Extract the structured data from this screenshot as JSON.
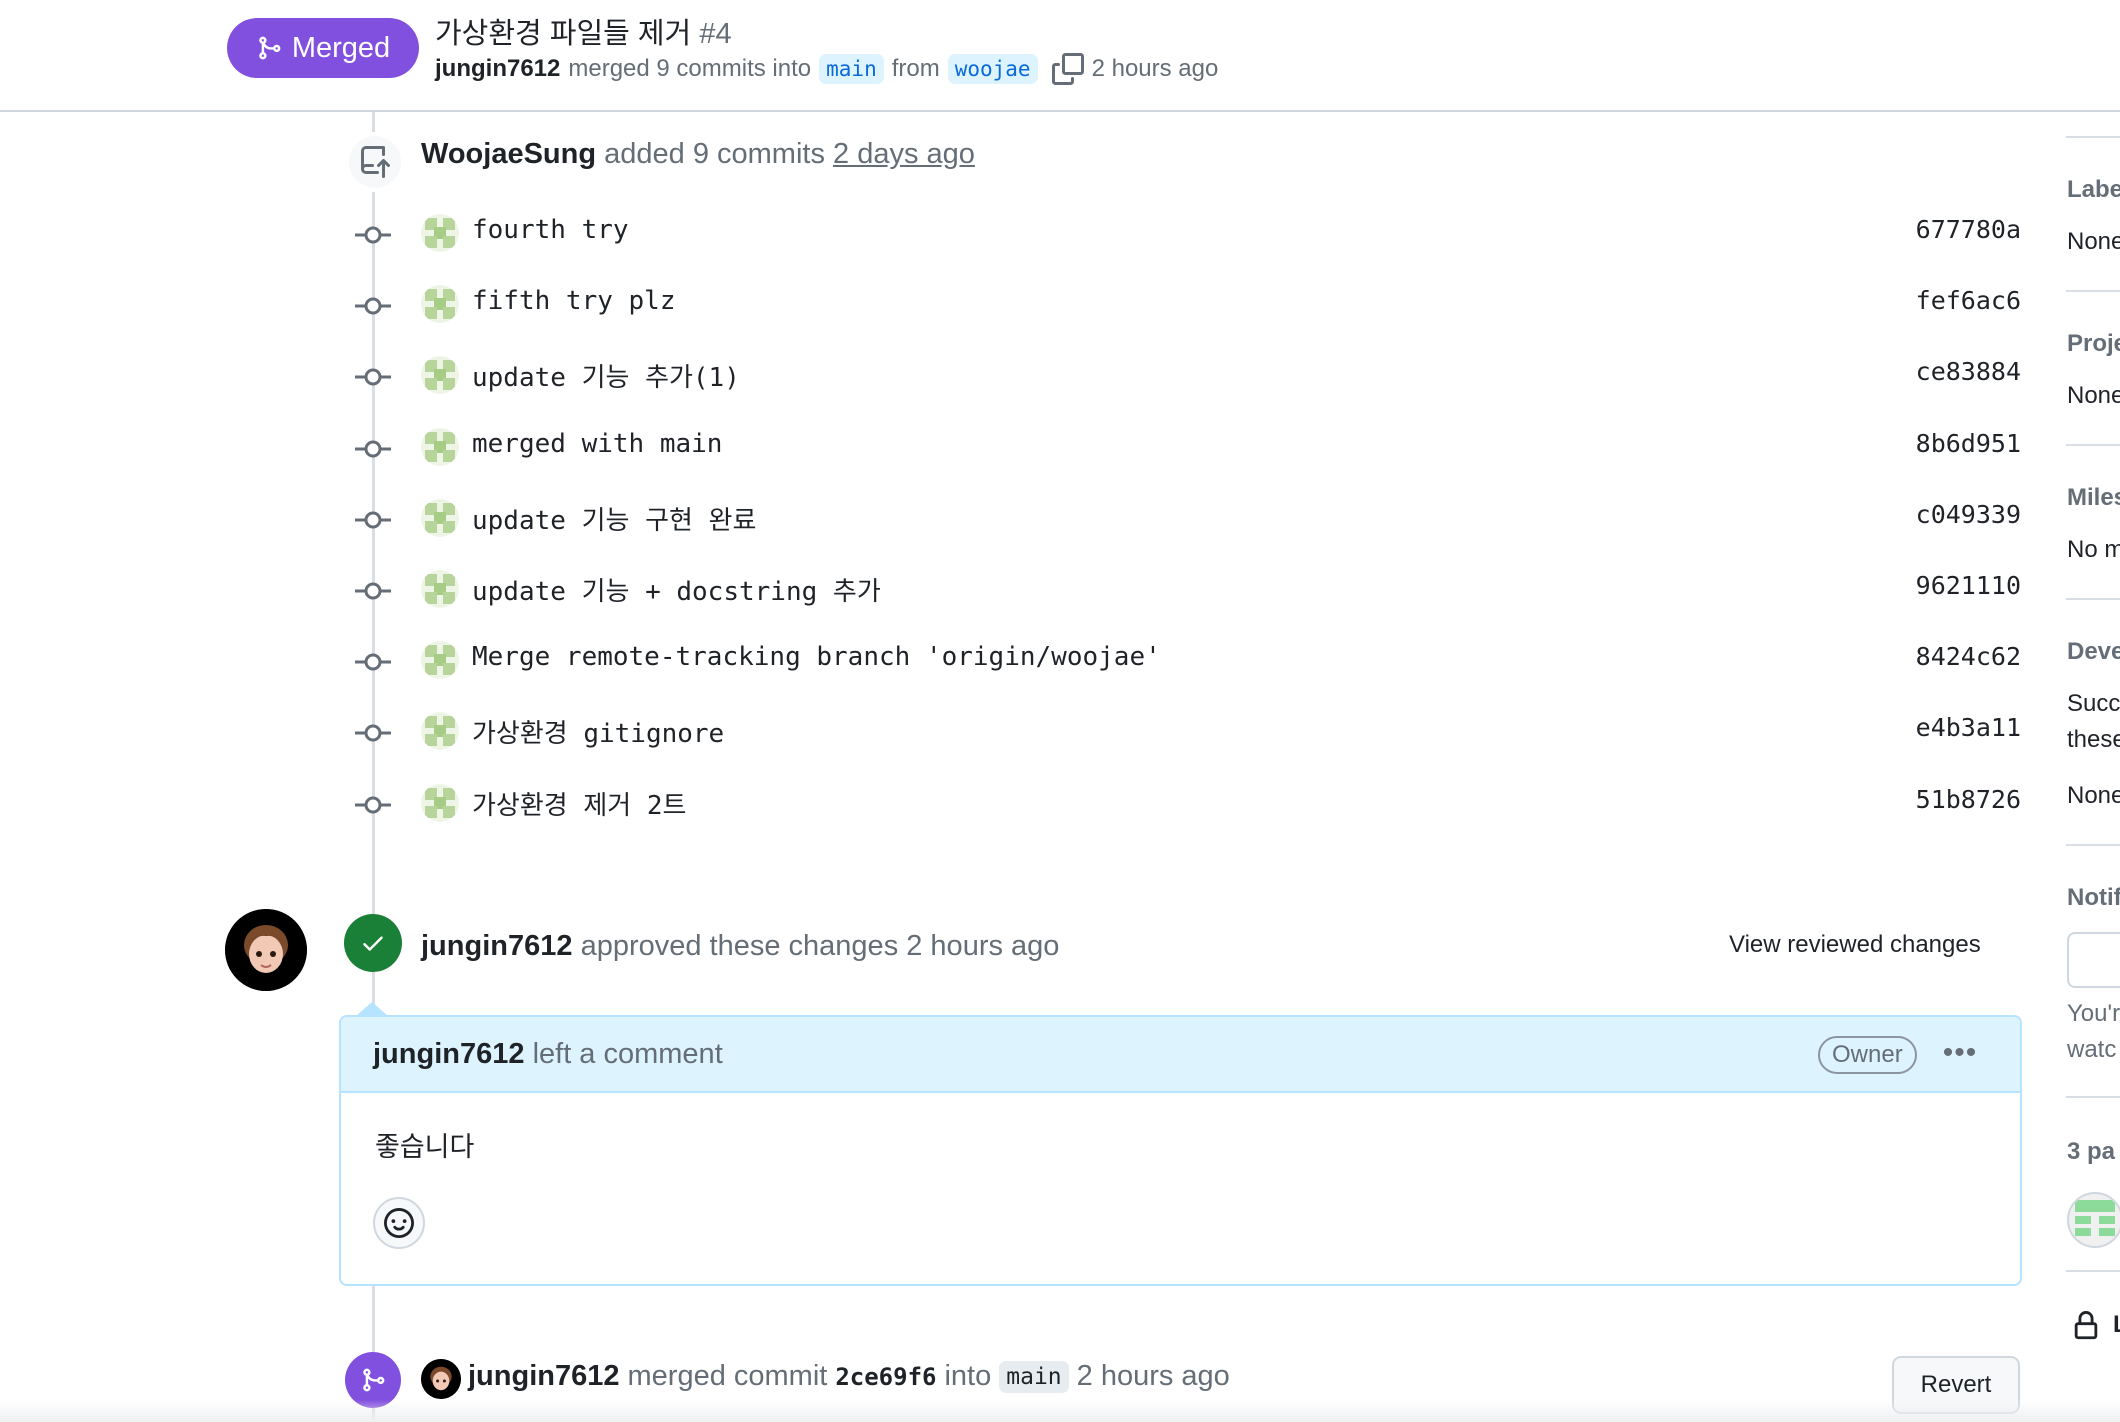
{
  "header": {
    "status_badge": "Merged",
    "title": "가상환경 파일들 제거",
    "number": "#4",
    "merger": "jungin7612",
    "merge_text": "merged 9 commits into",
    "base_branch": "main",
    "from_text": "from",
    "head_branch": "woojae",
    "time": "2 hours ago"
  },
  "push_event": {
    "author": "WoojaeSung",
    "action": "added 9 commits",
    "time": "2 days ago"
  },
  "commits": [
    {
      "message": "fourth try",
      "sha": "677780a"
    },
    {
      "message": "fifth try plz",
      "sha": "fef6ac6"
    },
    {
      "message": "update 기능 추가(1)",
      "sha": "ce83884"
    },
    {
      "message": "merged with main",
      "sha": "8b6d951"
    },
    {
      "message": "update 기능 구현 완료",
      "sha": "c049339"
    },
    {
      "message": "update 기능 + docstring 추가",
      "sha": "9621110"
    },
    {
      "message": "Merge remote-tracking branch 'origin/woojae'",
      "sha": "8424c62"
    },
    {
      "message": "가상환경 gitignore",
      "sha": "e4b3a11"
    },
    {
      "message": "가상환경 제거 2트",
      "sha": "51b8726"
    }
  ],
  "review": {
    "reviewer": "jungin7612",
    "action": "approved these changes 2 hours ago",
    "view_link": "View reviewed changes",
    "comment_author": "jungin7612",
    "comment_action": "left a comment",
    "role_badge": "Owner",
    "more": "•••",
    "body": "좋습니다"
  },
  "merge_event": {
    "author": "jungin7612",
    "text1": "merged commit",
    "sha": "2ce69f6",
    "text2": "into",
    "branch": "main",
    "time": "2 hours ago",
    "revert_label": "Revert"
  },
  "sidebar": {
    "labels_title": "Labe",
    "labels_value": "None",
    "projects_title": "Proje",
    "projects_value": "None",
    "milestone_title": "Miles",
    "milestone_value": "No m",
    "development_title": "Deve",
    "development_text1": "Succ",
    "development_text2": "these",
    "development_value": "None",
    "notifications_title": "Notif",
    "notifications_text1": "You'r",
    "notifications_text2": "watc",
    "participants_title": "3 pa",
    "lock_text": "L"
  },
  "colors": {
    "merged_purple": "#8250df",
    "approved_green": "#1a7f37",
    "link_blue": "#0969da",
    "comment_header_bg": "#ddf4ff"
  }
}
